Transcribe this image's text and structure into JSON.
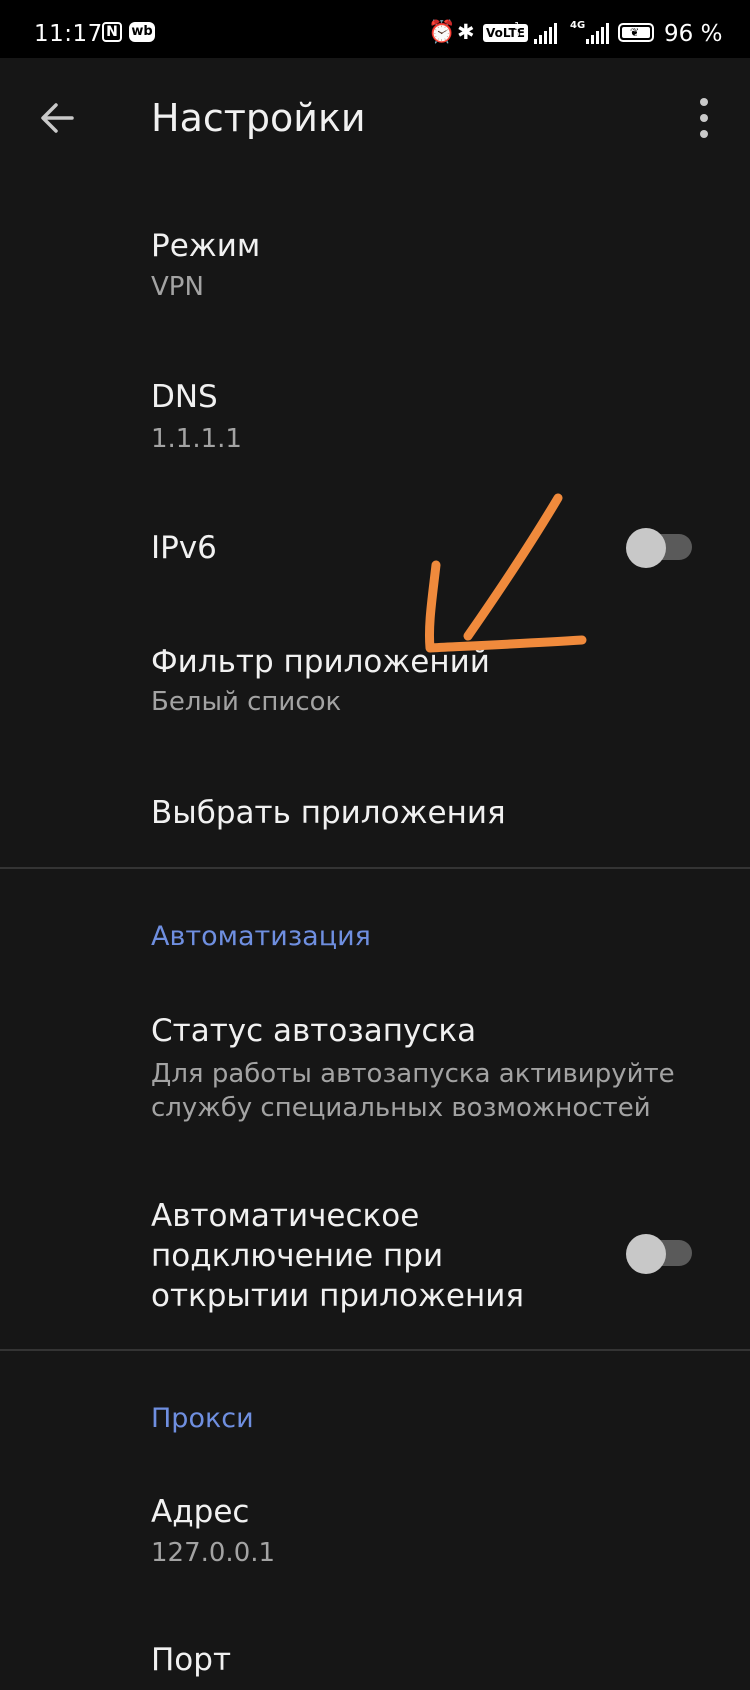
{
  "status_bar": {
    "time": "11:17",
    "nfc": "N",
    "wb": "wb",
    "volte": "VoLTE",
    "sim1": "1",
    "sim2": "2",
    "network": "4G",
    "battery_text": "96 %",
    "battery_level": 0.96
  },
  "app_bar": {
    "title": "Настройки",
    "back_icon": "arrow-back-icon",
    "more_icon": "more-vertical-icon"
  },
  "settings": {
    "mode": {
      "title": "Режим",
      "value": "VPN"
    },
    "dns": {
      "title": "DNS",
      "value": "1.1.1.1"
    },
    "ipv6": {
      "title": "IPv6",
      "enabled": false
    },
    "app_filter": {
      "title": "Фильтр приложений",
      "value": "Белый список"
    },
    "choose_apps": {
      "title": "Выбрать приложения"
    }
  },
  "automation": {
    "header": "Автоматизация",
    "autostart": {
      "title": "Статус автозапуска",
      "desc_line1": "Для работы автозапуска активируйте",
      "desc_line2": "службу специальных возможностей"
    },
    "auto_connect": {
      "line1": "Автоматическое",
      "line2": "подключение при",
      "line3": "открытии приложения",
      "enabled": false
    }
  },
  "proxy": {
    "header": "Прокси",
    "address": {
      "title": "Адрес",
      "value": "127.0.0.1"
    },
    "port": {
      "title": "Порт"
    }
  },
  "colors": {
    "background": "#161616",
    "accent": "#6f8fe0",
    "annotation_arrow": "#f08a3c"
  }
}
